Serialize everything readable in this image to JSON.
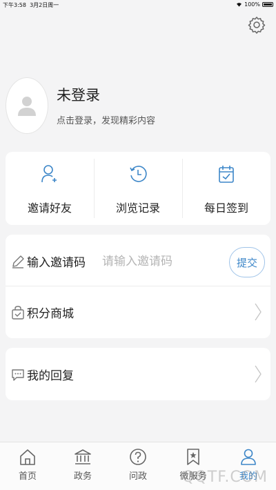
{
  "status_bar": {
    "time": "下午3:58",
    "date": "3月2日周一",
    "battery": "100%"
  },
  "profile": {
    "name": "未登录",
    "subtitle": "点击登录，发现精彩内容"
  },
  "quick_actions": [
    {
      "label": "邀请好友",
      "icon": "invite-user-icon"
    },
    {
      "label": "浏览记录",
      "icon": "history-clock-icon"
    },
    {
      "label": "每日签到",
      "icon": "calendar-check-icon"
    }
  ],
  "menu": {
    "invite_code": {
      "label": "输入邀请码",
      "placeholder": "请输入邀请码",
      "submit": "提交"
    },
    "points_mall": {
      "label": "积分商城"
    },
    "my_replies": {
      "label": "我的回复"
    }
  },
  "tabbar": [
    {
      "label": "首页",
      "icon": "home-icon"
    },
    {
      "label": "政务",
      "icon": "government-icon"
    },
    {
      "label": "问政",
      "icon": "question-icon"
    },
    {
      "label": "微服务",
      "icon": "bookmark-star-icon"
    },
    {
      "label": "我的",
      "icon": "user-icon",
      "active": true
    }
  ],
  "watermark": "QQTF.COM",
  "colors": {
    "accent": "#3c86c8",
    "background": "#f4f4f5"
  }
}
